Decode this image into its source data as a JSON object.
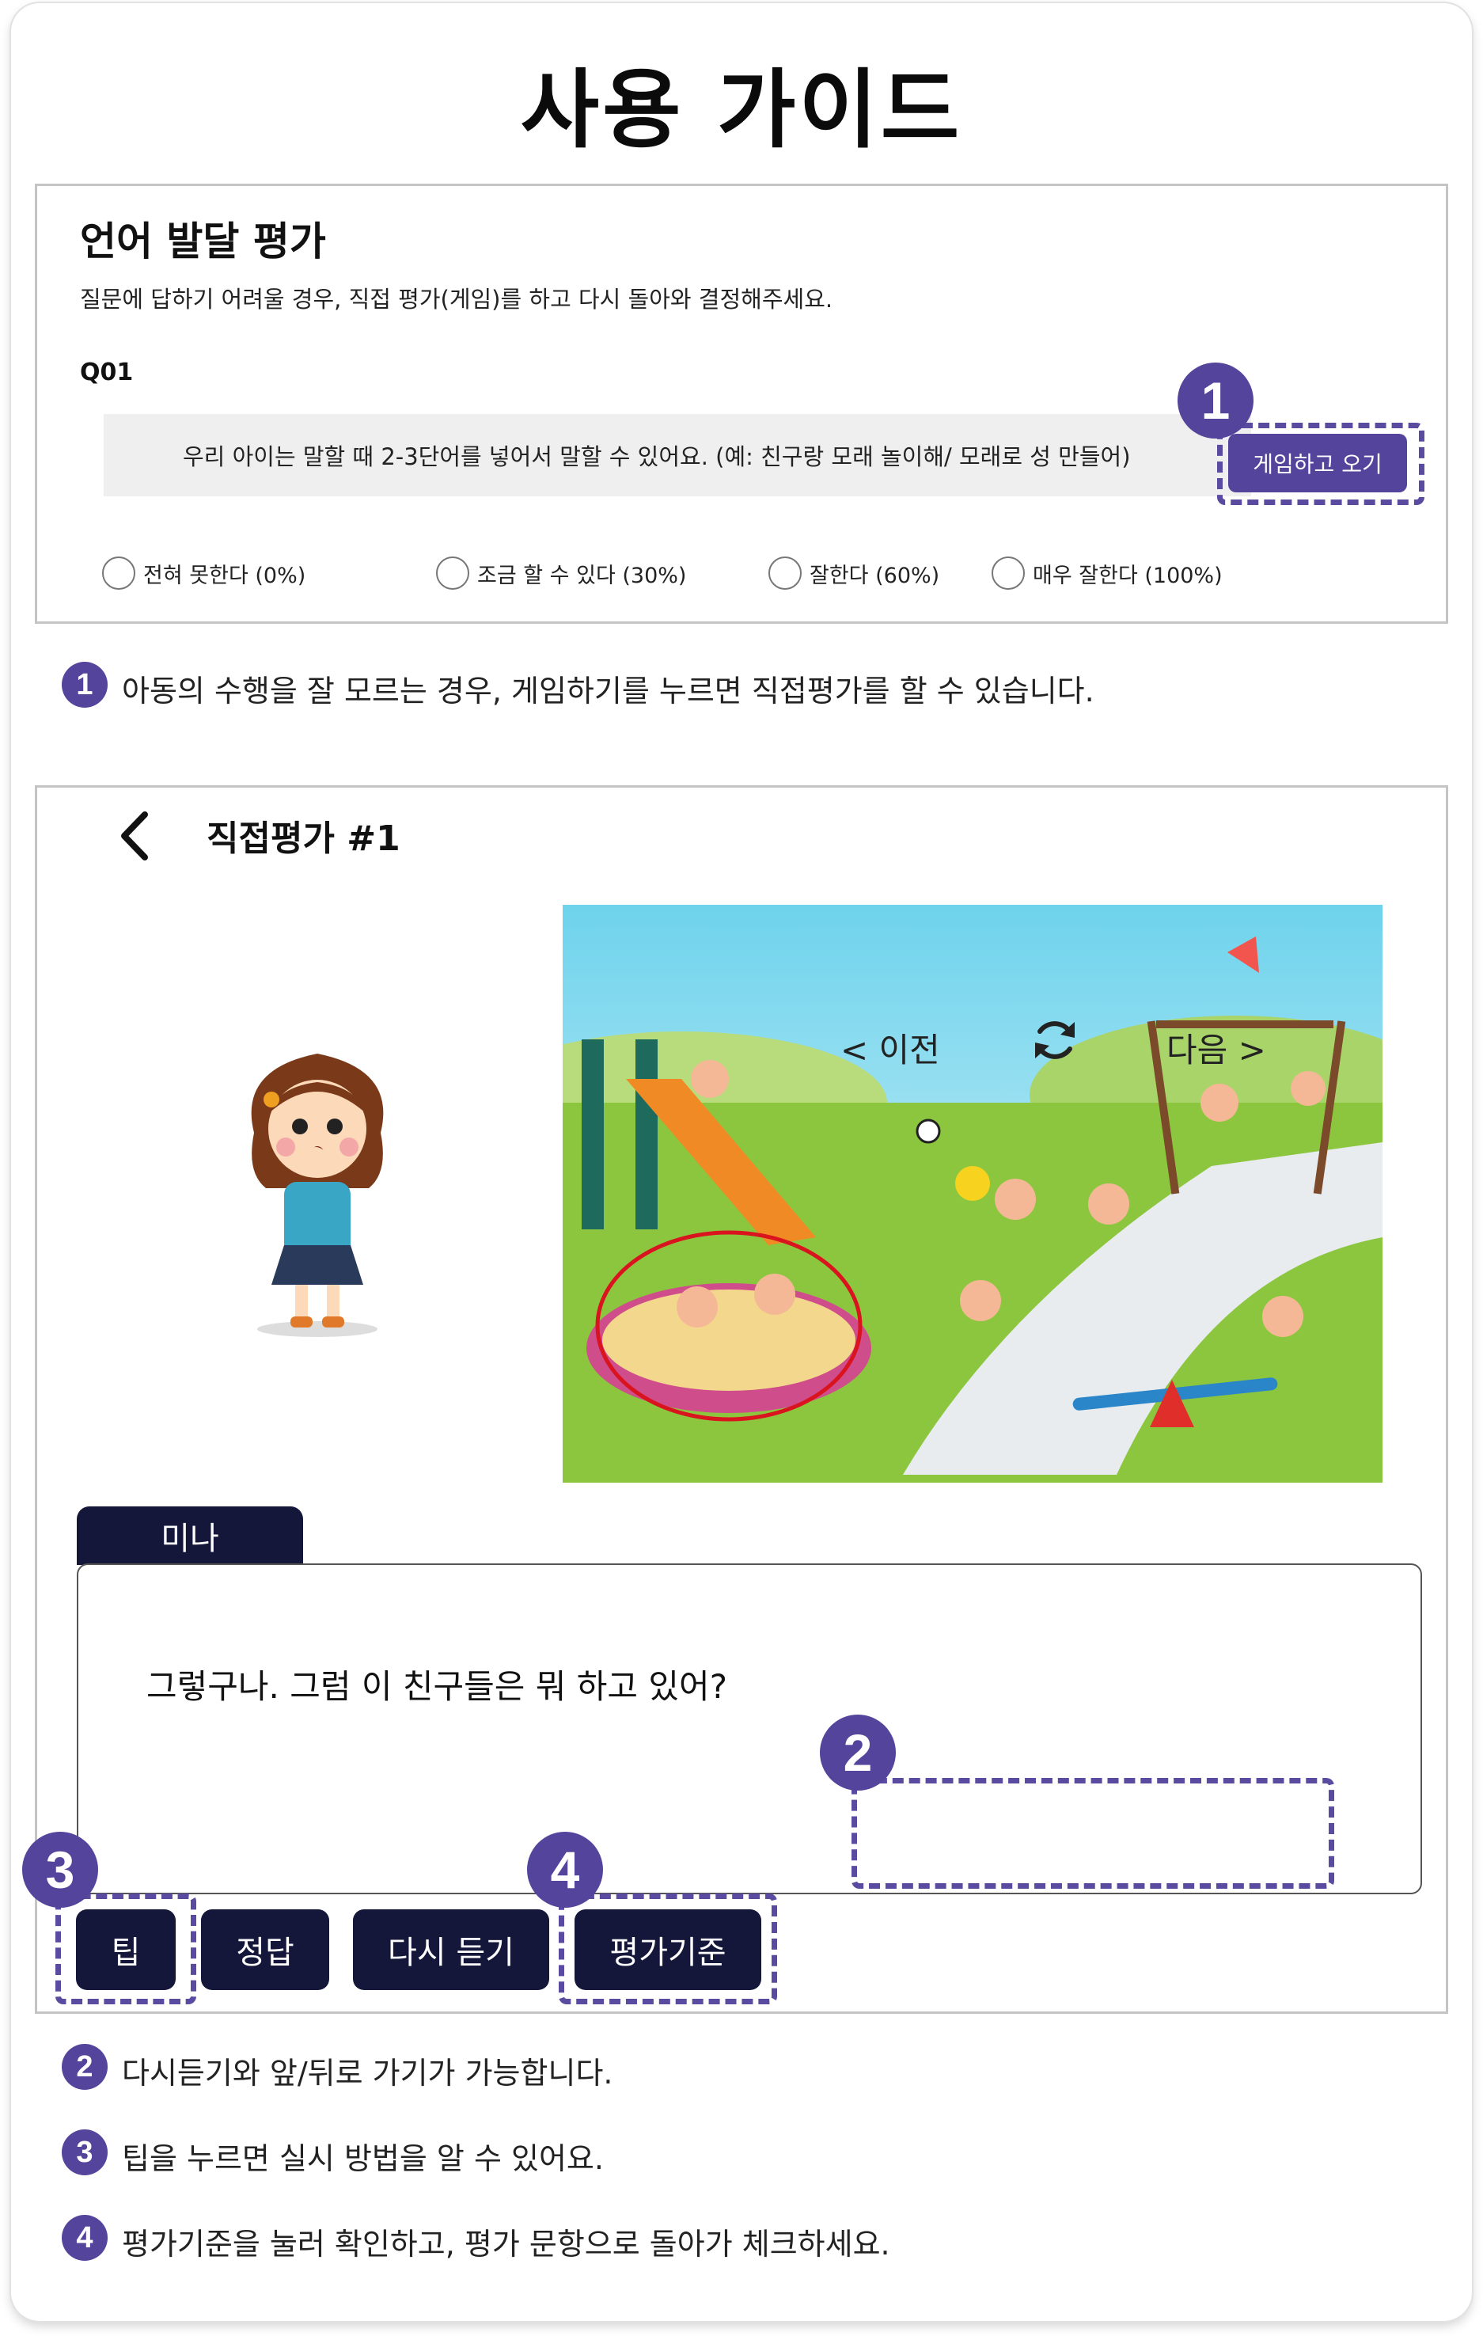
{
  "page": {
    "title": "사용 가이드"
  },
  "section1": {
    "title": "언어 발달 평가",
    "subtitle": "질문에 답하기 어려울 경우, 직접 평가(게임)를 하고 다시 돌아와 결정해주세요.",
    "question_number": "Q01",
    "question_text": "우리 아이는 말할 때 2-3단어를 넣어서 말할 수 있어요. (예: 친구랑 모래 놀이해/ 모래로 성 만들어)",
    "game_button": "게임하고 오기",
    "options": [
      "전혀 못한다 (0%)",
      "조금 할 수 있다 (30%)",
      "잘한다 (60%)",
      "매우 잘한다 (100%)"
    ]
  },
  "badges": {
    "one": "1",
    "two": "2",
    "three": "3",
    "four": "4"
  },
  "notes": {
    "note1": "아동의 수행을 잘 모르는 경우, 게임하기를 누르면 직접평가를 할 수 있습니다.",
    "note2": "다시듣기와 앞/뒤로 가기가 가능합니다.",
    "note3": "팁을 누르면 실시 방법을 알 수 있어요.",
    "note4": "평가기준을 눌러 확인하고, 평가 문항으로 돌아가 체크하세요."
  },
  "section2": {
    "title": "직접평가 #1",
    "speaker": "미나",
    "dialog": "그렇구나. 그럼 이 친구들은 뭐 하고 있어?",
    "prev": "< 이전",
    "next": "다음 >",
    "buttons": {
      "tip": "팁",
      "answer": "정답",
      "replay": "다시 듣기",
      "criteria": "평가기준"
    }
  },
  "colors": {
    "accent": "#55449b",
    "dark_button": "#14173a",
    "question_bg": "#efefef"
  },
  "icons": [
    "back-arrow-icon",
    "refresh-icon",
    "radio-icon"
  ]
}
